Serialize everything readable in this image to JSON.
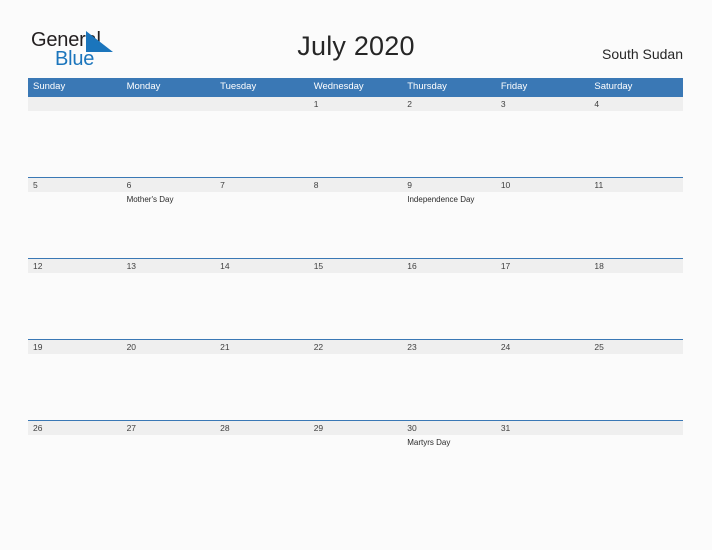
{
  "brand": {
    "name_part1": "General",
    "name_part2": "Blue",
    "flag_icon": "blue-triangle-flag-icon",
    "accent_color": "#1b75bc"
  },
  "header": {
    "title": "July 2020",
    "region": "South Sudan"
  },
  "theme": {
    "header_blue": "#3a78b5",
    "row_band_gray": "#efefef",
    "page_background": "#fbfbfb",
    "text_dark": "#262626"
  },
  "calendar": {
    "month": "July",
    "year": "2020",
    "day_headers": [
      "Sunday",
      "Monday",
      "Tuesday",
      "Wednesday",
      "Thursday",
      "Friday",
      "Saturday"
    ],
    "weeks": [
      {
        "days": [
          {
            "num": "",
            "event": ""
          },
          {
            "num": "",
            "event": ""
          },
          {
            "num": "",
            "event": ""
          },
          {
            "num": "1",
            "event": ""
          },
          {
            "num": "2",
            "event": ""
          },
          {
            "num": "3",
            "event": ""
          },
          {
            "num": "4",
            "event": ""
          }
        ]
      },
      {
        "days": [
          {
            "num": "5",
            "event": ""
          },
          {
            "num": "6",
            "event": "Mother's Day"
          },
          {
            "num": "7",
            "event": ""
          },
          {
            "num": "8",
            "event": ""
          },
          {
            "num": "9",
            "event": "Independence Day"
          },
          {
            "num": "10",
            "event": ""
          },
          {
            "num": "11",
            "event": ""
          }
        ]
      },
      {
        "days": [
          {
            "num": "12",
            "event": ""
          },
          {
            "num": "13",
            "event": ""
          },
          {
            "num": "14",
            "event": ""
          },
          {
            "num": "15",
            "event": ""
          },
          {
            "num": "16",
            "event": ""
          },
          {
            "num": "17",
            "event": ""
          },
          {
            "num": "18",
            "event": ""
          }
        ]
      },
      {
        "days": [
          {
            "num": "19",
            "event": ""
          },
          {
            "num": "20",
            "event": ""
          },
          {
            "num": "21",
            "event": ""
          },
          {
            "num": "22",
            "event": ""
          },
          {
            "num": "23",
            "event": ""
          },
          {
            "num": "24",
            "event": ""
          },
          {
            "num": "25",
            "event": ""
          }
        ]
      },
      {
        "days": [
          {
            "num": "26",
            "event": ""
          },
          {
            "num": "27",
            "event": ""
          },
          {
            "num": "28",
            "event": ""
          },
          {
            "num": "29",
            "event": ""
          },
          {
            "num": "30",
            "event": "Martyrs Day"
          },
          {
            "num": "31",
            "event": ""
          },
          {
            "num": "",
            "event": ""
          }
        ]
      }
    ]
  }
}
